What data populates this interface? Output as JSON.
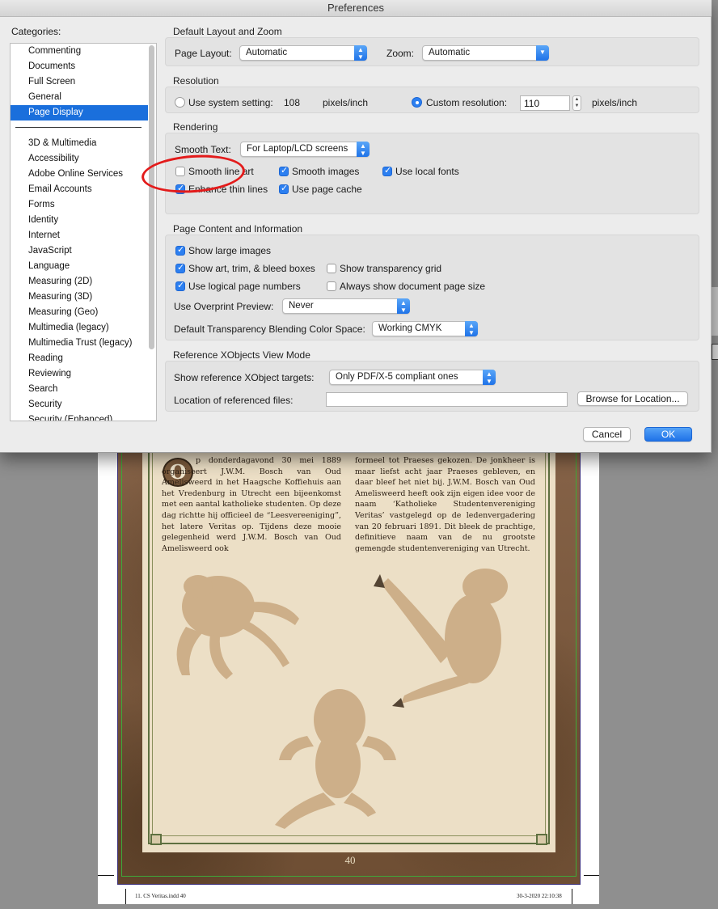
{
  "window": {
    "title": "Preferences"
  },
  "categories": {
    "label": "Categories:",
    "top_items": [
      "Commenting",
      "Documents",
      "Full Screen",
      "General",
      "Page Display"
    ],
    "selected": "Page Display",
    "other_items": [
      "3D & Multimedia",
      "Accessibility",
      "Adobe Online Services",
      "Email Accounts",
      "Forms",
      "Identity",
      "Internet",
      "JavaScript",
      "Language",
      "Measuring (2D)",
      "Measuring (3D)",
      "Measuring (Geo)",
      "Multimedia (legacy)",
      "Multimedia Trust (legacy)",
      "Reading",
      "Reviewing",
      "Search",
      "Security",
      "Security (Enhanced)"
    ]
  },
  "layout_zoom": {
    "title": "Default Layout and Zoom",
    "page_layout_label": "Page Layout:",
    "page_layout_value": "Automatic",
    "zoom_label": "Zoom:",
    "zoom_value": "Automatic"
  },
  "resolution": {
    "title": "Resolution",
    "system_label": "Use system setting:",
    "system_value": "108",
    "system_unit": "pixels/inch",
    "custom_label": "Custom resolution:",
    "custom_value": "110",
    "custom_unit": "pixels/inch",
    "selected": "custom"
  },
  "rendering": {
    "title": "Rendering",
    "smooth_text_label": "Smooth Text:",
    "smooth_text_value": "For Laptop/LCD screens",
    "smooth_line_art": {
      "label": "Smooth line art",
      "checked": false
    },
    "smooth_images": {
      "label": "Smooth images",
      "checked": true
    },
    "use_local_fonts": {
      "label": "Use local fonts",
      "checked": true
    },
    "enhance_thin_lines": {
      "label": "Enhance thin lines",
      "checked": true
    },
    "use_page_cache": {
      "label": "Use page cache",
      "checked": true
    }
  },
  "page_content": {
    "title": "Page Content and Information",
    "show_large_images": {
      "label": "Show large images",
      "checked": true
    },
    "show_art_trim_bleed": {
      "label": "Show art, trim, & bleed boxes",
      "checked": true
    },
    "show_transparency_grid": {
      "label": "Show transparency grid",
      "checked": false
    },
    "use_logical_page_numbers": {
      "label": "Use logical page numbers",
      "checked": true
    },
    "always_show_doc_page_size": {
      "label": "Always show document page size",
      "checked": false
    },
    "overprint_label": "Use Overprint Preview:",
    "overprint_value": "Never",
    "blending_label": "Default Transparency Blending Color Space:",
    "blending_value": "Working CMYK"
  },
  "xobjects": {
    "title": "Reference XObjects View Mode",
    "targets_label": "Show reference XObject targets:",
    "targets_value": "Only PDF/X-5 compliant ones",
    "location_label": "Location of referenced files:",
    "location_value": "",
    "browse_label": "Browse for Location..."
  },
  "buttons": {
    "cancel": "Cancel",
    "ok": "OK"
  },
  "colors": {
    "accent": "#1f72e8",
    "annotation": "#e31b1b",
    "selection": "#1a6fdc"
  },
  "document": {
    "dropcap_letter": "O",
    "col_left": "p donderdagavond 30 mei 1889 organiseert J.W.M. Bosch van Oud Amelisweerd in het Haagsche Koffiehuis aan het Vredenburg in Utrecht een bijeenkomst met een aantal katholieke studenten. Op deze dag richtte hij officieel de “Leesvereeniging”, het latere Veritas op. Tijdens deze mooie gelegenheid werd J.W.M. Bosch van Oud Amelisweerd ook",
    "col_right": "formeel tot Praeses gekozen. De jonkheer is maar liefst acht jaar Praeses gebleven, en daar bleef het niet bij. J.W.M. Bosch van Oud Amelisweerd heeft ook zijn eigen idee voor de naam ‘Katholieke Studentenvereniging Veritas’ vastgelegd op de ledenvergadering van 20 februari 1891. Dit bleek de prachtige, definitieve naam van de nu grootste gemengde studentenvereniging van Utrecht.",
    "page_number": "40",
    "slug_left": "11. CS Veritas.indd   40",
    "slug_right": "30-3-2020   22:10:38"
  }
}
